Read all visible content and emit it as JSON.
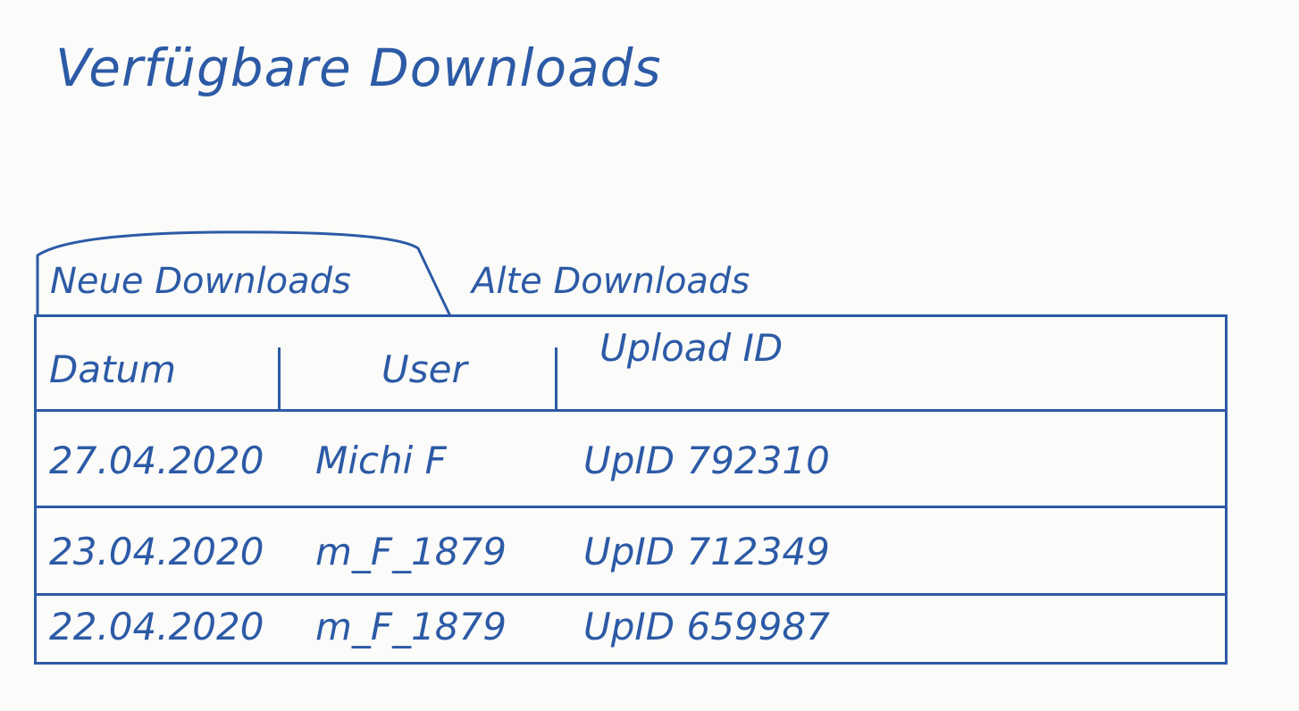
{
  "page": {
    "title": "Verfügbare Downloads"
  },
  "tabs": [
    {
      "label": "Neue Downloads",
      "active": true
    },
    {
      "label": "Alte Downloads",
      "active": false
    }
  ],
  "table": {
    "columns": [
      "Datum",
      "User",
      "Upload ID"
    ],
    "rows": [
      {
        "date": "27.04.2020",
        "user": "Michi F",
        "upload_id": "UpID 792310"
      },
      {
        "date": "23.04.2020",
        "user": "m_F_1879",
        "upload_id": "UpID 712349"
      },
      {
        "date": "22.04.2020",
        "user": "m_F_1879",
        "upload_id": "UpID 659987"
      }
    ]
  },
  "colors": {
    "ink": "#2c5aa6",
    "paper": "#fbfbf9"
  }
}
